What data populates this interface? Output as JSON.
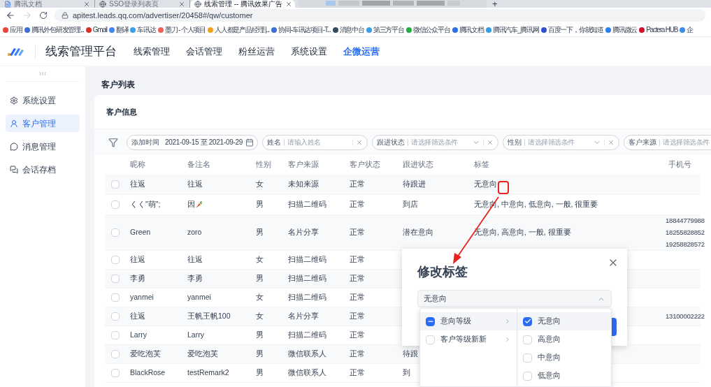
{
  "browser": {
    "tabs": [
      {
        "title": "腾讯文档",
        "kind": "doc",
        "selected": false
      },
      {
        "title": "SSO登录列表页",
        "kind": "globe",
        "selected": false
      },
      {
        "title": "线索管理 -- 腾讯效果广告",
        "kind": "globe",
        "selected": true
      },
      {
        "kind": "blurred"
      }
    ],
    "new_tab": "+",
    "url": "apitest.leads.qq.com/advertiser/20458#/qw/customer",
    "bookmarks": [
      {
        "label": "应用",
        "color": "#e8453c"
      },
      {
        "label": "腾讯外包研发管理...",
        "color": "#3b6fd8"
      },
      {
        "label": "Gmail",
        "color": "#d93025"
      },
      {
        "label": "翻译",
        "color": "#4285f4"
      },
      {
        "label": "车讯达",
        "color": "#3aa0e8"
      },
      {
        "label": "墨刀 - 个人项目",
        "color": "#f0605a"
      },
      {
        "label": "人人都是产品经理 |...",
        "color": "#f0a020"
      },
      {
        "label": "协同-车讯达项目-T...",
        "color": "#3b6fd8"
      },
      {
        "label": "消息中台",
        "color": "#2f4f5f"
      },
      {
        "label": "第三方平台",
        "color": "#3aa0e8"
      },
      {
        "label": "微信公众平台",
        "color": "#20b040"
      },
      {
        "label": "腾讯文档",
        "color": "#2a6fe8"
      },
      {
        "label": "腾讯汽车_腾讯网",
        "color": "#30a0e0"
      },
      {
        "label": "百度一下，你就知道",
        "color": "#3050d0"
      },
      {
        "label": "腾讯微云",
        "color": "#2a80f0"
      },
      {
        "label": "Pactera HUB",
        "color": "#d0102a"
      },
      {
        "label": "企",
        "color": "#3a8ee8"
      }
    ]
  },
  "header": {
    "title": "线索管理平台",
    "nav": [
      {
        "label": "线索管理",
        "selected": false
      },
      {
        "label": "会话管理",
        "selected": false
      },
      {
        "label": "粉丝运营",
        "selected": false
      },
      {
        "label": "系统设置",
        "selected": false
      },
      {
        "label": "企微运营",
        "selected": true
      }
    ]
  },
  "sidebar": {
    "items": [
      {
        "label": "系统设置",
        "kind": "gear",
        "selected": false
      },
      {
        "label": "客户管理",
        "kind": "user",
        "selected": true
      },
      {
        "label": "消息管理",
        "kind": "message",
        "selected": false
      },
      {
        "label": "会话存档",
        "kind": "chats",
        "selected": false
      }
    ]
  },
  "page_title": "客户列表",
  "card_title": "客户信息",
  "filters": [
    {
      "label": "添加时间",
      "kind": "date",
      "value": "2021-09-15 至 2021-09-29"
    },
    {
      "label": "姓名",
      "kind": "text",
      "placeholder": "请输入姓名"
    },
    {
      "label": "跟进状态",
      "kind": "select",
      "placeholder": "请选择筛选条件"
    },
    {
      "label": "性别",
      "kind": "select",
      "placeholder": "请选择筛选条件"
    },
    {
      "label": "客户来源",
      "kind": "select",
      "placeholder": "请选择筛选条件"
    }
  ],
  "table": {
    "columns": [
      "昵称",
      "备注名",
      "性别",
      "客户来源",
      "客户状态",
      "跟进状态",
      "标签",
      "手机号"
    ],
    "rows": [
      {
        "checked": false,
        "nickname": "往返",
        "remark": "往返",
        "gender": "女",
        "source": "未知来源",
        "status": "正常",
        "follow_up": "待跟进",
        "tags": "无意向"
      },
      {
        "checked": false,
        "nickname": "くく\"萌\";",
        "remark": "因",
        "remark_carrot": true,
        "gender": "男",
        "source": "扫描二维码",
        "status": "正常",
        "follow_up": "到店",
        "tags": "无意向, 中意向, 低意向, 一般, 很重要"
      },
      {
        "checked": false,
        "nickname": "Green",
        "remark": "zoro",
        "gender": "男",
        "source": "名片分享",
        "status": "正常",
        "follow_up": "潜在意向",
        "tags": "无意向, 高意向, 一般, 很重要",
        "phones": [
          "18844779988",
          "18255828852",
          "19258828572"
        ]
      },
      {
        "checked": false,
        "nickname": "往返",
        "remark": "往返",
        "gender": "女",
        "source": "扫描二维码",
        "status": "正常"
      },
      {
        "checked": false,
        "nickname": "李勇",
        "remark": "李勇",
        "gender": "男",
        "source": "扫描二维码",
        "status": "正常"
      },
      {
        "checked": false,
        "nickname": "yanmei",
        "remark": "yanmei",
        "gender": "女",
        "source": "扫描二维码",
        "status": "正常"
      },
      {
        "checked": false,
        "nickname": "往返",
        "remark": "王帆王帆100",
        "gender": "女",
        "source": "名片分享",
        "status": "正常",
        "phones": [
          "13100002222"
        ]
      },
      {
        "checked": false,
        "nickname": "Larry",
        "remark": "Larry",
        "gender": "男",
        "source": "扫描二维码",
        "status": "正常"
      },
      {
        "checked": false,
        "nickname": "爱吃泡芙",
        "remark": "爱吃泡芙",
        "gender": "男",
        "source": "微信联系人",
        "status": "正常",
        "follow_up": "待跟"
      },
      {
        "checked": false,
        "nickname": "BlackRose",
        "remark": "testRemark2",
        "gender": "男",
        "source": "微信联系人",
        "status": "正常",
        "follow_up": "到"
      }
    ]
  },
  "dialog": {
    "title": "修改标签",
    "value": "无意向",
    "groups": [
      {
        "label": "意向等级",
        "checked": false,
        "indeterminate": true,
        "selected": true
      },
      {
        "label": "客户等级新新",
        "checked": false,
        "indeterminate": false,
        "selected": false
      }
    ],
    "options": [
      {
        "label": "无意向",
        "checked": true,
        "selected": true
      },
      {
        "label": "高意向",
        "checked": false,
        "selected": false
      },
      {
        "label": "中意向",
        "checked": false,
        "selected": false
      },
      {
        "label": "低意向",
        "checked": false,
        "selected": false
      }
    ]
  }
}
